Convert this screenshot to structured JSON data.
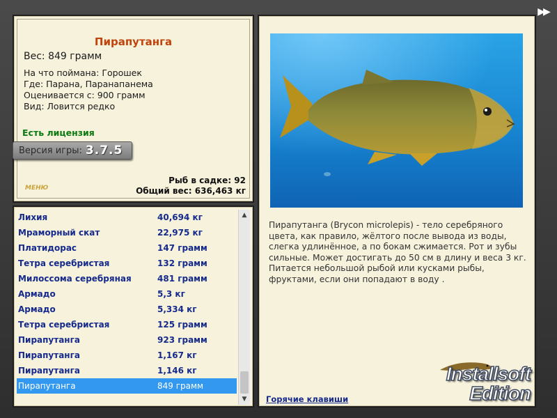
{
  "window": {
    "ff_icon": "fast-forward-icon",
    "ff_glyph": "▶▶"
  },
  "info": {
    "fish_name": "Пирапутанга",
    "weight": "Вес: 849 грамм",
    "caught_with": "На что поймана: Горошек",
    "location": "Где: Парана, Паранапанема",
    "valued_from": "Оценивается с: 900 грамм",
    "type": "Вид: Ловится редко",
    "license": "Есть лицензия",
    "version_label": "Версия игры:",
    "version_number": "3.7.5",
    "menu_logo": "МЕНЮ",
    "fish_in_cage": "Рыб в садке: 92",
    "total_weight": "Общий вес: 636,463 кг"
  },
  "catch_list": {
    "rows": [
      {
        "name": "Лихия",
        "weight": "40,694 кг"
      },
      {
        "name": "Мраморный скат",
        "weight": "22,975 кг"
      },
      {
        "name": "Платидорас",
        "weight": "147 грамм"
      },
      {
        "name": "Тетра серебристая",
        "weight": "132 грамм"
      },
      {
        "name": "Милоссома серебряная",
        "weight": "481 грамм"
      },
      {
        "name": "Армадо",
        "weight": "5,3 кг"
      },
      {
        "name": "Армадо",
        "weight": "5,334 кг"
      },
      {
        "name": "Тетра серебристая",
        "weight": "125 грамм"
      },
      {
        "name": "Пирапутанга",
        "weight": "923 грамм"
      },
      {
        "name": "Пирапутанга",
        "weight": "1,167 кг"
      },
      {
        "name": "Пирапутанга",
        "weight": "1,146 кг"
      },
      {
        "name": "Пирапутанга",
        "weight": "849 грамм"
      }
    ],
    "selected_index": 11,
    "scroll_up_glyph": "▲",
    "scroll_down_glyph": "▼"
  },
  "detail": {
    "description": "Пирапутанга (Brycon microlepis) - тело серебряного цвета, как правило, жёлтого после вывода из воды, слегка удлинённое, а по бокам сжимается. Рот и зубы сильные. Может достигать до 50 см в длину и веса 3 кг. Питается небольшой рыбой или кусками рыбы, фруктами, если они попадают в воду .",
    "hotkeys_link": "Горячие клавиши",
    "edition_line1": "Installsoft",
    "edition_line2": "Edition"
  },
  "colors": {
    "panel_bg": "#f6f2dc",
    "fish_name": "#c0440c",
    "license": "#0b7a10",
    "list_text": "#152a8c",
    "selected_row": "#3399f0",
    "water": "#1a8fd8"
  }
}
